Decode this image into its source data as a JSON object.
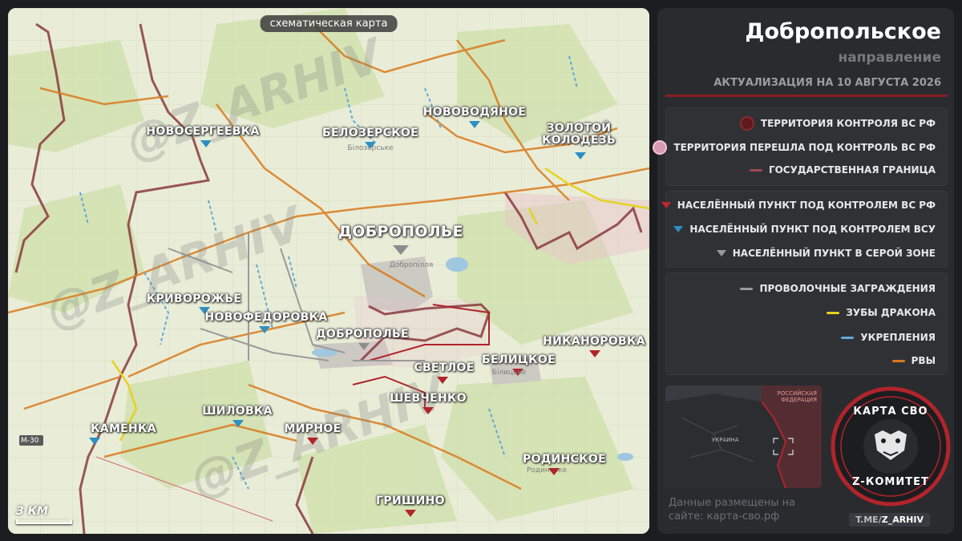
{
  "map": {
    "label": "схематическая карта",
    "scale": "3 КМ",
    "watermarks": [
      "@Z_ARHIV",
      "@Z_ARHIV",
      "@Z_ARHIV"
    ],
    "colors": {
      "ru_control": "#b0242b",
      "ua_control": "#2d8fc2",
      "grey_zone": "#8c8c8c",
      "border": "#8a3a3e",
      "wire": "#9a9a9a",
      "dragon_teeth": "#e6d21e",
      "fortifications": "#62a8d8",
      "trenches": "#d97a1e"
    },
    "settlements": [
      {
        "name": "НОВОСЕРГЕЕВКА",
        "control": "ua"
      },
      {
        "name": "БЕЛОЗЕРСКОЕ",
        "control": "ua",
        "local": "Білозерське"
      },
      {
        "name": "НОВОВОДЯНОЕ",
        "control": "ua"
      },
      {
        "name": "ЗОЛОТОЙ КОЛОДЕЗЬ",
        "control": "ua"
      },
      {
        "name": "ДОБРОПОЛЬЕ",
        "control": "grey",
        "local": "Добропілля"
      },
      {
        "name": "КРИВОРОЖЬЕ",
        "control": "ua"
      },
      {
        "name": "НОВОФЕДОРОВКА",
        "control": "ua"
      },
      {
        "name": "ДОБРОПОЛЬЕ",
        "control": "grey"
      },
      {
        "name": "СВЕТЛОЕ",
        "control": "ru"
      },
      {
        "name": "БЕЛИЦКОЕ",
        "control": "ru",
        "local": "Білицьке"
      },
      {
        "name": "НИКАНОРОВКА",
        "control": "ru"
      },
      {
        "name": "ШЕВЧЕНКО",
        "control": "ru"
      },
      {
        "name": "ШИЛОВКА",
        "control": "ua"
      },
      {
        "name": "КАМЕНКА",
        "control": "ua"
      },
      {
        "name": "МИРНОЕ",
        "control": "ru"
      },
      {
        "name": "РОДИНСКОЕ",
        "control": "ru",
        "local": "Родинське"
      },
      {
        "name": "ГРИШИНО",
        "control": "ru"
      }
    ],
    "road_sign": "М-30"
  },
  "panel": {
    "title": "Добропольское",
    "subtitle": "направление",
    "update": "АКТУАЛИЗАЦИЯ НА 10 АВГУСТА 2026",
    "legend_areas": [
      {
        "label": "ТЕРРИТОРИЯ КОНТРОЛЯ ВС РФ",
        "color": "#5e1a1c"
      },
      {
        "label": "ТЕРРИТОРИЯ ПЕРЕШЛА ПОД КОНТРОЛЬ ВС РФ",
        "color": "#d79ab0"
      },
      {
        "label": "ГОСУДАРСТВЕННАЯ ГРАНИЦА",
        "color": "#9a4a4c"
      }
    ],
    "legend_settlements": [
      {
        "label": "НАСЕЛЁННЫЙ ПУНКТ ПОД КОНТРОЛЕМ ВС РФ",
        "color": "#c2262d"
      },
      {
        "label": "НАСЕЛЁННЫЙ ПУНКТ ПОД КОНТРОЛЕМ ВСУ",
        "color": "#2d8fc2"
      },
      {
        "label": "НАСЕЛЁННЫЙ ПУНКТ В СЕРОЙ ЗОНЕ",
        "color": "#9a9a9a"
      }
    ],
    "legend_lines": [
      {
        "label": "ПРОВОЛОЧНЫЕ ЗАГРАЖДЕНИЯ",
        "color": "#9a9a9a"
      },
      {
        "label": "ЗУБЫ ДРАКОНА",
        "color": "#e6d21e"
      },
      {
        "label": "УКРЕПЛЕНИЯ",
        "color": "#62a8d8"
      },
      {
        "label": "РВЫ",
        "color": "#d97a1e"
      }
    ],
    "minimap": {
      "russia": "РОССИЙСКАЯ ФЕДЕРАЦИЯ",
      "ukraine": "УКРАИНА"
    },
    "emblem": {
      "top": "КАРТА СВО",
      "bottom": "Z-КОМИТЕТ"
    },
    "site_note": "Данные размещены на сайте: карта-сво.рф",
    "telegram": {
      "prefix": "T.ME/",
      "handle": "Z_ARHIV"
    }
  }
}
